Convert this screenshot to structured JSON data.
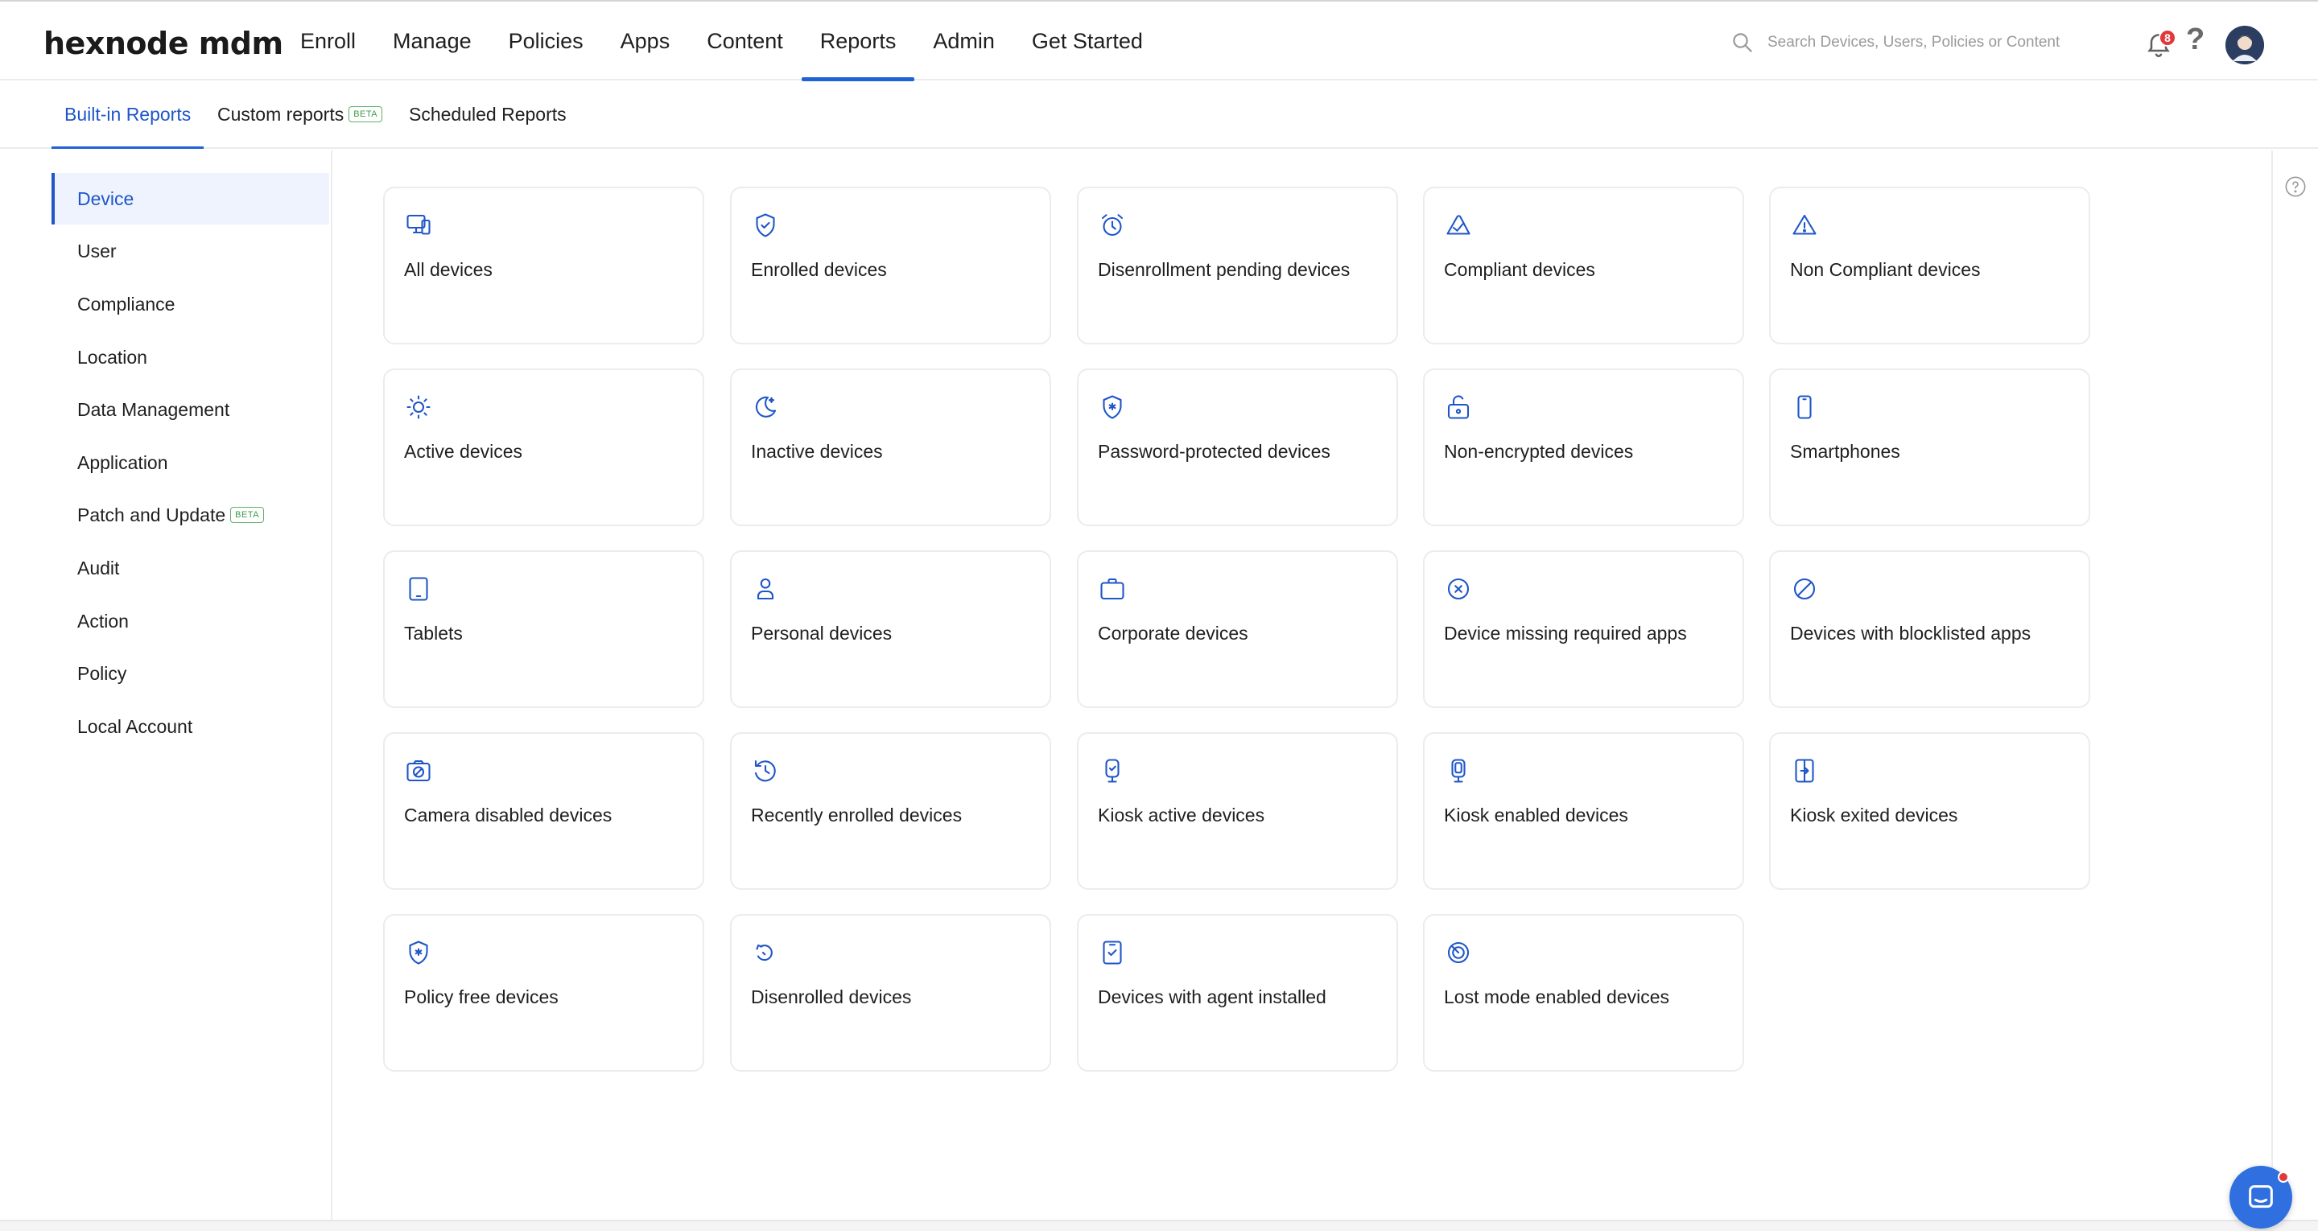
{
  "app": {
    "logo_text": "hexnode mdm",
    "accent_color": "#1f56c8"
  },
  "nav": {
    "items": [
      {
        "label": "Enroll"
      },
      {
        "label": "Manage"
      },
      {
        "label": "Policies"
      },
      {
        "label": "Apps"
      },
      {
        "label": "Content"
      },
      {
        "label": "Reports",
        "active": true
      },
      {
        "label": "Admin"
      },
      {
        "label": "Get Started"
      }
    ]
  },
  "header": {
    "search_placeholder": "Search Devices, Users, Policies or Content",
    "notification_count": "8",
    "help_glyph": "?"
  },
  "subtabs": {
    "builtin": "Built-in Reports",
    "custom": "Custom reports",
    "custom_badge": "BETA",
    "scheduled": "Scheduled Reports"
  },
  "sidebar": {
    "items": [
      {
        "label": "Device",
        "active": true
      },
      {
        "label": "User"
      },
      {
        "label": "Compliance"
      },
      {
        "label": "Location"
      },
      {
        "label": "Data Management"
      },
      {
        "label": "Application"
      },
      {
        "label": "Patch and Update",
        "badge": "BETA"
      },
      {
        "label": "Audit"
      },
      {
        "label": "Action"
      },
      {
        "label": "Policy"
      },
      {
        "label": "Local Account"
      }
    ]
  },
  "reports": [
    {
      "label": "All devices",
      "icon": "monitor-icon"
    },
    {
      "label": "Enrolled devices",
      "icon": "shield-check-icon"
    },
    {
      "label": "Disenrollment pending devices",
      "icon": "alarm-clock-icon"
    },
    {
      "label": "Compliant devices",
      "icon": "compliant-check-icon"
    },
    {
      "label": "Non Compliant devices",
      "icon": "warning-triangle-icon"
    },
    {
      "label": "Active devices",
      "icon": "sun-icon"
    },
    {
      "label": "Inactive devices",
      "icon": "moon-icon"
    },
    {
      "label": "Password-protected devices",
      "icon": "shield-asterisk-icon"
    },
    {
      "label": "Non-encrypted devices",
      "icon": "unlocked-icon"
    },
    {
      "label": "Smartphones",
      "icon": "smartphone-icon"
    },
    {
      "label": "Tablets",
      "icon": "tablet-icon"
    },
    {
      "label": "Personal devices",
      "icon": "person-icon"
    },
    {
      "label": "Corporate devices",
      "icon": "briefcase-icon"
    },
    {
      "label": "Device missing required apps",
      "icon": "x-circle-icon"
    },
    {
      "label": "Devices with blocklisted apps",
      "icon": "block-icon"
    },
    {
      "label": "Camera disabled devices",
      "icon": "camera-off-icon"
    },
    {
      "label": "Recently enrolled devices",
      "icon": "history-icon"
    },
    {
      "label": "Kiosk active devices",
      "icon": "kiosk-active-icon"
    },
    {
      "label": "Kiosk enabled devices",
      "icon": "kiosk-enabled-icon"
    },
    {
      "label": "Kiosk exited devices",
      "icon": "kiosk-exit-icon"
    },
    {
      "label": "Policy free devices",
      "icon": "shield-asterisk-icon"
    },
    {
      "label": "Disenrolled devices",
      "icon": "unlink-icon"
    },
    {
      "label": "Devices with agent installed",
      "icon": "agent-check-icon"
    },
    {
      "label": "Lost mode enabled devices",
      "icon": "lost-mode-icon"
    }
  ]
}
